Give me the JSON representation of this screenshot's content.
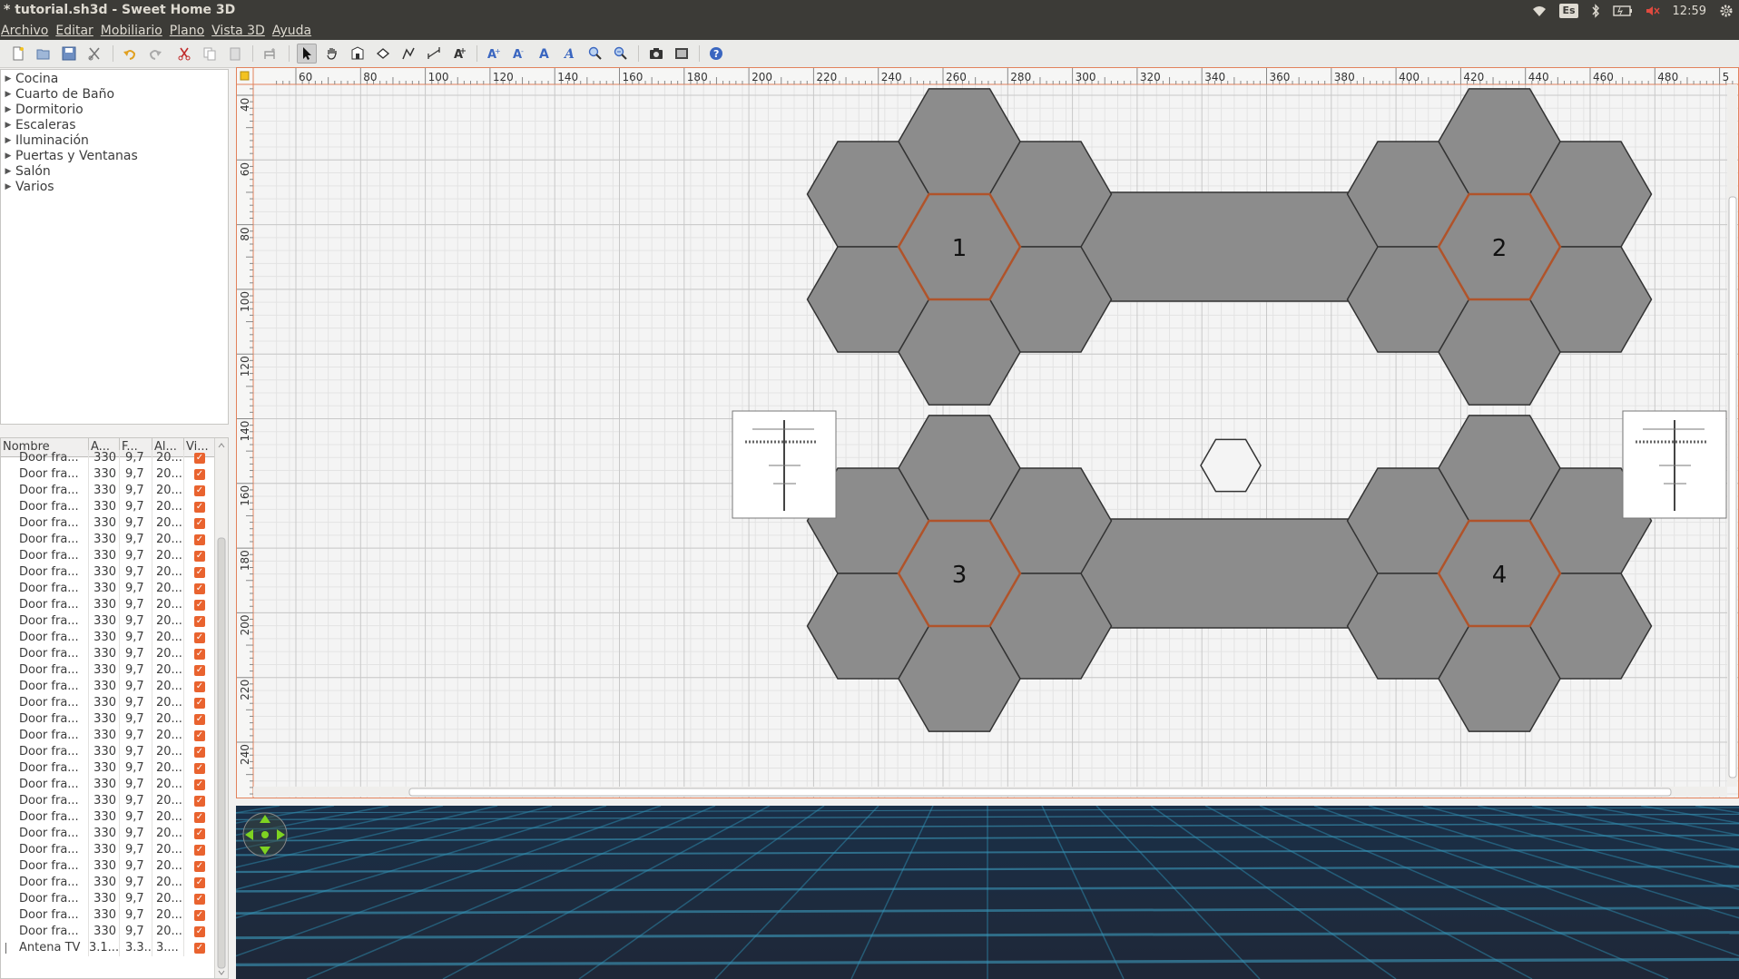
{
  "window": {
    "title": "* tutorial.sh3d - Sweet Home 3D"
  },
  "indicators": {
    "keyboard": "Es",
    "clock": "12:59"
  },
  "menubar": [
    "Archivo",
    "Editar",
    "Mobiliario",
    "Plano",
    "Vista 3D",
    "Ayuda"
  ],
  "toolbar": {
    "buttons": [
      "new-icon",
      "open-icon",
      "save-icon",
      "cut-preferences-icon",
      "undo-icon",
      "redo-icon",
      "cut-icon",
      "copy-icon",
      "paste-icon",
      "add-furniture-icon",
      "select-icon",
      "pan-icon",
      "create-walls-icon",
      "create-rooms-icon",
      "create-polylines-icon",
      "create-dimensions-icon",
      "create-labels-icon",
      "increase-text-icon",
      "decrease-text-icon",
      "bold-text-icon",
      "italic-text-icon",
      "zoom-in-icon",
      "zoom-out-icon",
      "create-photo-icon",
      "create-video-icon",
      "help-icon"
    ],
    "active": "select-icon"
  },
  "catalog": {
    "categories": [
      "Cocina",
      "Cuarto de Baño",
      "Dormitorio",
      "Escaleras",
      "Iluminación",
      "Puertas y Ventanas",
      "Salón",
      "Varios"
    ]
  },
  "furniture": {
    "columns": [
      "Nombre",
      "A...",
      "F...",
      "Al...",
      "Vi..."
    ],
    "rows": [
      {
        "name": "Door fra...",
        "w": "330",
        "d": "9,7",
        "h": "20...",
        "visible": true
      },
      {
        "name": "Door fra...",
        "w": "330",
        "d": "9,7",
        "h": "20...",
        "visible": true
      },
      {
        "name": "Door fra...",
        "w": "330",
        "d": "9,7",
        "h": "20...",
        "visible": true
      },
      {
        "name": "Door fra...",
        "w": "330",
        "d": "9,7",
        "h": "20...",
        "visible": true
      },
      {
        "name": "Door fra...",
        "w": "330",
        "d": "9,7",
        "h": "20...",
        "visible": true
      },
      {
        "name": "Door fra...",
        "w": "330",
        "d": "9,7",
        "h": "20...",
        "visible": true
      },
      {
        "name": "Door fra...",
        "w": "330",
        "d": "9,7",
        "h": "20...",
        "visible": true
      },
      {
        "name": "Door fra...",
        "w": "330",
        "d": "9,7",
        "h": "20...",
        "visible": true
      },
      {
        "name": "Door fra...",
        "w": "330",
        "d": "9,7",
        "h": "20...",
        "visible": true
      },
      {
        "name": "Door fra...",
        "w": "330",
        "d": "9,7",
        "h": "20...",
        "visible": true
      },
      {
        "name": "Door fra...",
        "w": "330",
        "d": "9,7",
        "h": "20...",
        "visible": true
      },
      {
        "name": "Door fra...",
        "w": "330",
        "d": "9,7",
        "h": "20...",
        "visible": true
      },
      {
        "name": "Door fra...",
        "w": "330",
        "d": "9,7",
        "h": "20...",
        "visible": true
      },
      {
        "name": "Door fra...",
        "w": "330",
        "d": "9,7",
        "h": "20...",
        "visible": true
      },
      {
        "name": "Door fra...",
        "w": "330",
        "d": "9,7",
        "h": "20...",
        "visible": true
      },
      {
        "name": "Door fra...",
        "w": "330",
        "d": "9,7",
        "h": "20...",
        "visible": true
      },
      {
        "name": "Door fra...",
        "w": "330",
        "d": "9,7",
        "h": "20...",
        "visible": true
      },
      {
        "name": "Door fra...",
        "w": "330",
        "d": "9,7",
        "h": "20...",
        "visible": true
      },
      {
        "name": "Door fra...",
        "w": "330",
        "d": "9,7",
        "h": "20...",
        "visible": true
      },
      {
        "name": "Door fra...",
        "w": "330",
        "d": "9,7",
        "h": "20...",
        "visible": true
      },
      {
        "name": "Door fra...",
        "w": "330",
        "d": "9,7",
        "h": "20...",
        "visible": true
      },
      {
        "name": "Door fra...",
        "w": "330",
        "d": "9,7",
        "h": "20...",
        "visible": true
      },
      {
        "name": "Door fra...",
        "w": "330",
        "d": "9,7",
        "h": "20...",
        "visible": true
      },
      {
        "name": "Door fra...",
        "w": "330",
        "d": "9,7",
        "h": "20...",
        "visible": true
      },
      {
        "name": "Door fra...",
        "w": "330",
        "d": "9,7",
        "h": "20...",
        "visible": true
      },
      {
        "name": "Door fra...",
        "w": "330",
        "d": "9,7",
        "h": "20...",
        "visible": true
      },
      {
        "name": "Door fra...",
        "w": "330",
        "d": "9,7",
        "h": "20...",
        "visible": true
      },
      {
        "name": "Door fra...",
        "w": "330",
        "d": "9,7",
        "h": "20...",
        "visible": true
      },
      {
        "name": "Door fra...",
        "w": "330",
        "d": "9,7",
        "h": "20...",
        "visible": true
      },
      {
        "name": "Door fra...",
        "w": "330",
        "d": "9,7",
        "h": "20...",
        "visible": true
      },
      {
        "name": "Antena TV",
        "w": "3.1...",
        "d": "3.3...",
        "h": "3....",
        "visible": true
      }
    ]
  },
  "plan": {
    "ruler_x": [
      "60",
      "80",
      "100",
      "120",
      "140",
      "160",
      "180",
      "200",
      "220",
      "240",
      "260",
      "280",
      "300",
      "320",
      "340",
      "360",
      "380",
      "400",
      "420",
      "440",
      "460",
      "480",
      "5"
    ],
    "ruler_y": [
      "40",
      "60",
      "80",
      "100",
      "120",
      "140",
      "160",
      "180",
      "200",
      "220",
      "240"
    ],
    "cluster_labels": [
      "1",
      "2",
      "3",
      "4"
    ],
    "colors": {
      "hex_fill": "#8c8c8c",
      "hex_stroke": "#333333",
      "selected_stroke": "#b0532a",
      "grid_major": "#c8c8c8",
      "grid_minor": "#e3e3e3"
    }
  },
  "view3d": {
    "navigator": "navigation-arrows-icon"
  }
}
